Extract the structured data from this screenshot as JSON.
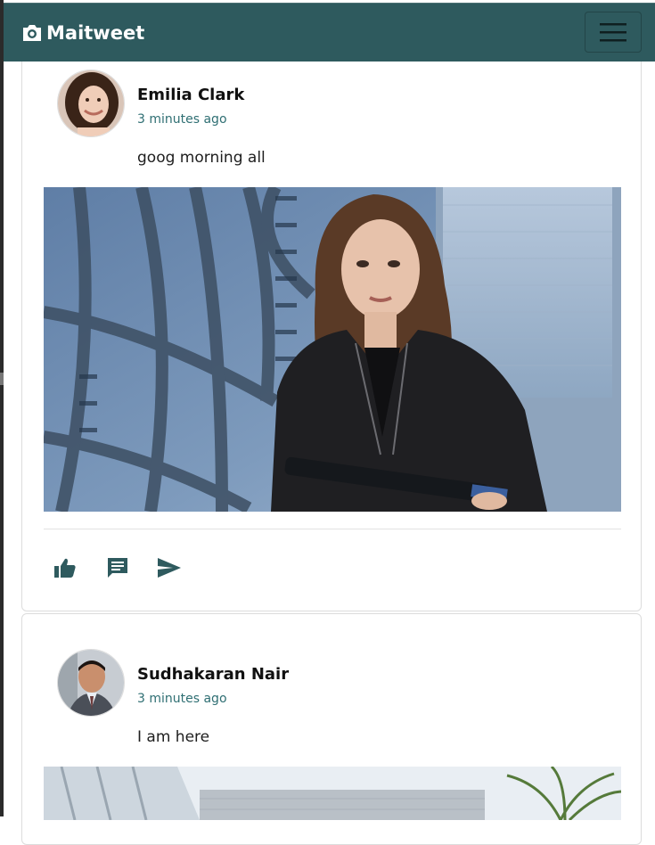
{
  "app": {
    "brand": "Maitweet",
    "accent": "#2e5a5e"
  },
  "navbar": {
    "menu_icon": "hamburger-icon",
    "brand_icon": "camera-icon"
  },
  "posts": [
    {
      "author": "Emilia Clark",
      "time": "3 minutes ago",
      "text": "goog morning all",
      "image": "photo of a woman in a black leather jacket holding a rifle against a blue metal wall",
      "actions": [
        "like-icon",
        "comment-icon",
        "share-icon"
      ]
    },
    {
      "author": "Sudhakaran Nair",
      "time": "3 minutes ago",
      "text": "I am here",
      "image": "photo of a modern building with palm trees"
    }
  ]
}
